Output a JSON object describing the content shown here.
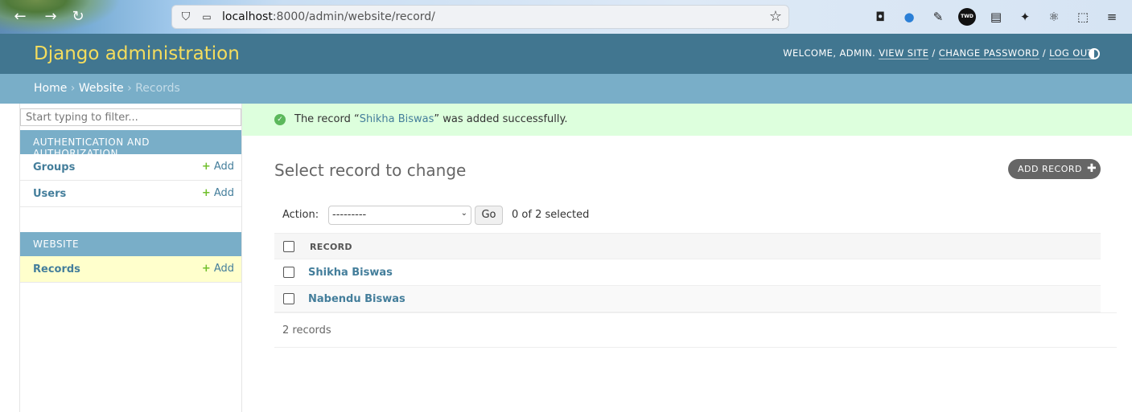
{
  "browser": {
    "url_host": "localhost",
    "url_rest": ":8000/admin/website/record/"
  },
  "header": {
    "branding": "Django administration",
    "welcome": "WELCOME, ",
    "user": "ADMIN",
    "view_site": "VIEW SITE",
    "change_password": "CHANGE PASSWORD",
    "log_out": "LOG OUT"
  },
  "breadcrumbs": {
    "home": "Home",
    "website": "Website",
    "current": "Records",
    "separator": "›"
  },
  "sidebar": {
    "filter_placeholder": "Start typing to filter...",
    "modules": [
      {
        "caption": "AUTHENTICATION AND AUTHORIZATION",
        "items": [
          {
            "name": "Groups",
            "add": "Add"
          },
          {
            "name": "Users",
            "add": "Add"
          }
        ]
      },
      {
        "caption": "WEBSITE",
        "items": [
          {
            "name": "Records",
            "add": "Add",
            "current": true
          }
        ]
      }
    ]
  },
  "message": {
    "prefix": "The record “",
    "link": "Shikha Biswas",
    "suffix": "” was added successfully."
  },
  "content": {
    "title": "Select record to change",
    "add_button": "ADD RECORD",
    "action_label": "Action:",
    "action_selected": "---------",
    "go": "Go",
    "counter": "0 of 2 selected",
    "column_header": "RECORD",
    "rows": [
      "Shikha Biswas",
      "Nabendu Biswas"
    ],
    "paginator": "2 records"
  },
  "colors": {
    "header": "#417690",
    "breadcrumbs": "#79aec8",
    "branding": "#f5dd5d",
    "link": "#447e9b",
    "success_bg": "#ddffdd",
    "add_plus": "#70bf2b"
  }
}
